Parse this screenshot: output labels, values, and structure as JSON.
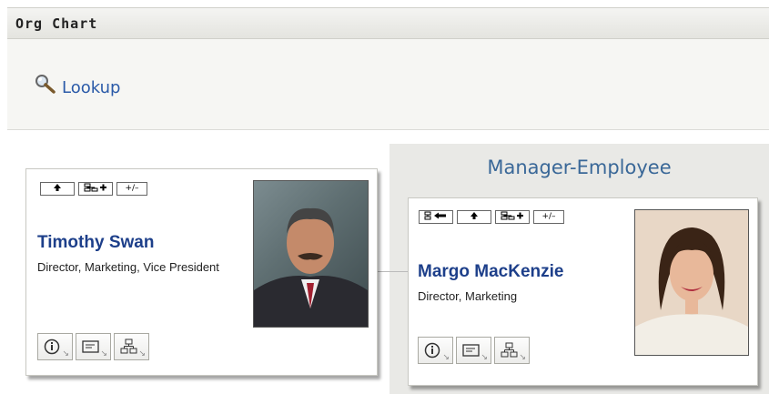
{
  "header": {
    "title": "Org Chart"
  },
  "lookup": {
    "label": "Lookup",
    "icon": "magnifier-icon"
  },
  "relationship": {
    "label": "Manager-Employee"
  },
  "cards": {
    "manager": {
      "name": "Timothy Swan",
      "title": "Director, Marketing, Vice President",
      "top_buttons": [
        "up-arrow",
        "show-reports",
        "+/-"
      ]
    },
    "employee": {
      "name": "Margo MacKenzie",
      "title": "Director, Marketing",
      "top_buttons": [
        "restore-root",
        "up-arrow",
        "show-reports",
        "+/-"
      ]
    }
  },
  "top_button_text": {
    "toggle": "+/–"
  },
  "actions": [
    "info",
    "email",
    "org"
  ]
}
